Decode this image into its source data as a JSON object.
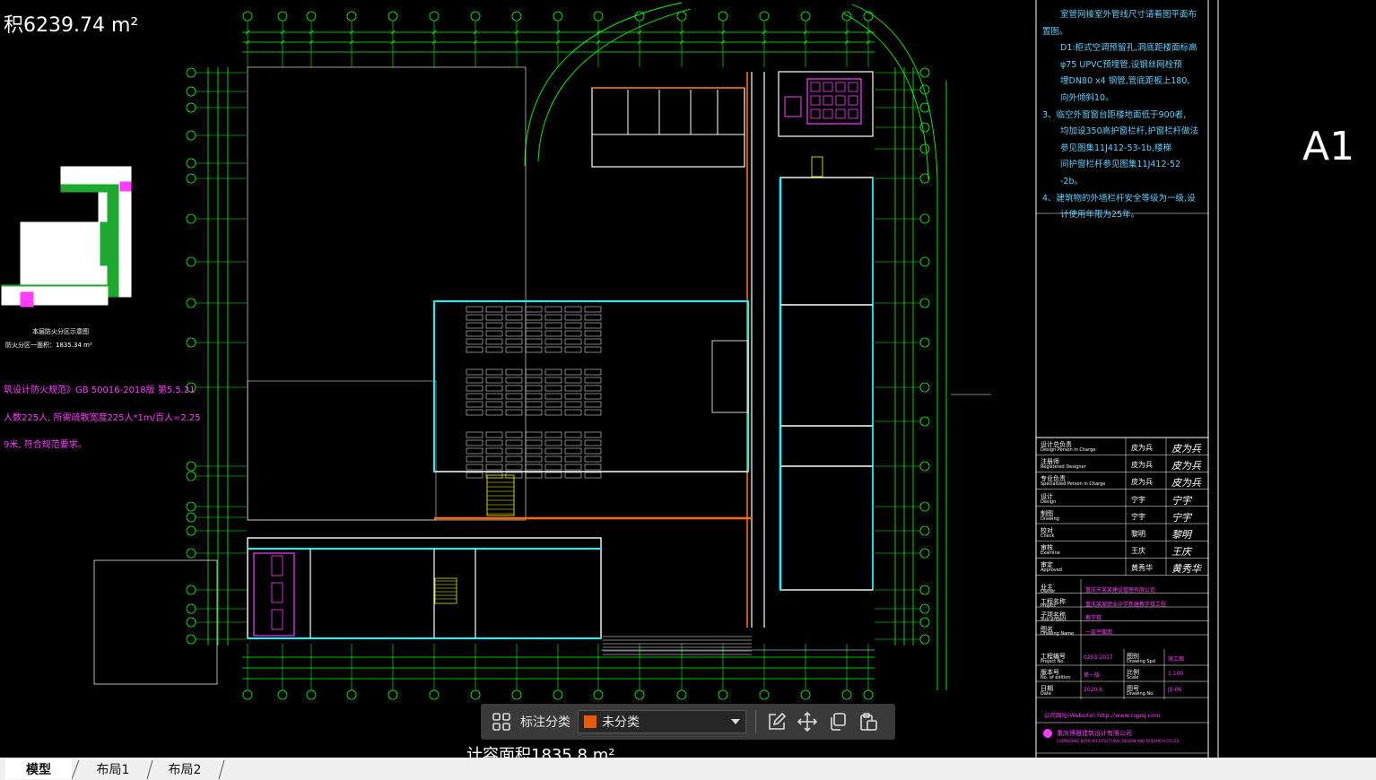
{
  "drawing": {
    "area_top": "积6239.74 m²",
    "area_bottom": "计容面积1835.8 m²",
    "sheet_size": "A1",
    "key_plan_caption": "本层防火分区示意图",
    "key_plan_area": "防火分区一面积：1835.34 m²",
    "fire_notes": [
      "筑设计防火规范》GB 50016-2018版 第5.5.21",
      "人数225人, 所需疏散宽度225人*1m/百人=2.25",
      "9米, 符合规范要求。"
    ],
    "general_notes": [
      "室管网接室外管线尺寸请看图平面布",
      "置图。",
      "D1:柜式空调预留孔,洞底距楼面标高",
      "φ75 UPVC预埋管,设钢丝网栓预",
      "埋DN80 x4 钢管,管底距板上180,",
      "向外倾斜10。",
      "3、临空外窗窗台距楼地面低于900者,",
      "均加设350高护窗栏杆,护窗栏杆做法",
      "参见图集11J412-53-1b,楼梯",
      "间护窗栏杆参见图集11J412-52",
      "-2b。",
      "4、建筑物的外墙栏杆安全等级为一级,设",
      "计使用年限为25年。"
    ],
    "title_block": {
      "roles": [
        {
          "role": "设计总负责",
          "role_en": "Design Person in Charge",
          "name": "皮为兵"
        },
        {
          "role": "注册师",
          "role_en": "Registered Designer",
          "name": "皮为兵"
        },
        {
          "role": "专业负责",
          "role_en": "Specialized Person in Charge",
          "name": "皮为兵"
        },
        {
          "role": "设计",
          "role_en": "Design",
          "name": "宁宇"
        },
        {
          "role": "制图",
          "role_en": "Drawing",
          "name": "宁宇"
        },
        {
          "role": "校对",
          "role_en": "Check",
          "name": "黎明"
        },
        {
          "role": "审核",
          "role_en": "Examine",
          "name": "王庆"
        },
        {
          "role": "审定",
          "role_en": "Approved",
          "name": "黄秀华"
        }
      ],
      "fields": [
        {
          "label": "业主",
          "label_en": "Owner",
          "value": "重庆市某某建设管理有限公司"
        },
        {
          "label": "工程名称",
          "label_en": "Project",
          "value": "重庆某某职业中学新建教学楼工程"
        },
        {
          "label": "子项名称",
          "label_en": "Sub-project",
          "value": "教学楼"
        },
        {
          "label": "图名",
          "label_en": "Drawing Name",
          "value": "一层平面图"
        }
      ],
      "meta": [
        {
          "label": "工程编号",
          "label_en": "Project No.",
          "value": "0203-2017",
          "label2": "图别",
          "label2_en": "Drawing Spd",
          "value2": "施工图"
        },
        {
          "label": "版本号",
          "label_en": "No. of edition",
          "value": "第一版",
          "label2": "比例",
          "label2_en": "Scale",
          "value2": "1:100"
        },
        {
          "label": "日期",
          "label_en": "Date",
          "value": "2020.6",
          "label2": "图号",
          "label2_en": "Drawing No.",
          "value2": "JS-06"
        }
      ],
      "website": "公司网址(Website):http://www.cqpsj.com",
      "company": "重庆博雅建筑设计有限公司",
      "company_en": "CHONGQING BOYA ARCHITECTURAL DESIGN AND RESEARCH CO.LTD"
    }
  },
  "toolbar": {
    "label": "标注分类",
    "select_value": "未分类",
    "swatch_color": "#e8590c",
    "buttons": [
      "grid-icon",
      "edit-icon",
      "move-icon",
      "copy-icon",
      "paste-icon"
    ]
  },
  "tabs": [
    {
      "label": "模型",
      "active": true
    },
    {
      "label": "布局1",
      "active": false
    },
    {
      "label": "布局2",
      "active": false
    }
  ],
  "colors": {
    "background": "#000000",
    "grid_lines": "#00ff00",
    "walls": "#ffffff",
    "windows": "#00ffff",
    "highlight": "#ff3cff",
    "orange": "#ff6a00"
  }
}
